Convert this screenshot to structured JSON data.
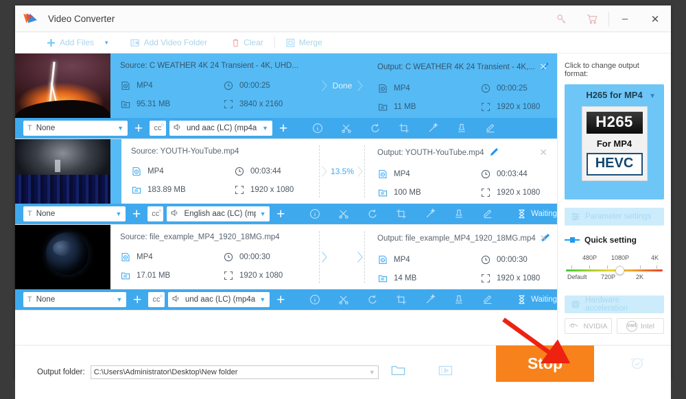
{
  "window": {
    "title": "Video Converter",
    "logo_icon": "video-converter-logo",
    "key_icon": "key-icon",
    "cart_icon": "shopping-cart-icon",
    "minimize_label": "–",
    "close_label": "✕"
  },
  "toolbar": {
    "add_files": "Add Files",
    "add_files_caret": "▾",
    "add_video_folder": "Add Video Folder",
    "clear": "Clear",
    "merge": "Merge"
  },
  "files": [
    {
      "thumb": "lightning-storm-thumbnail",
      "state": "done",
      "status": "Done",
      "source_label": "Source: C  WEATHER  4K 24  Transient - 4K, UHD...",
      "source_format": "MP4",
      "source_duration": "00:00:25",
      "source_size": "95.31 MB",
      "source_resolution": "3840 x 2160",
      "output_label": "Output: C  WEATHER  4K 24  Transient - 4K,...",
      "output_format": "MP4",
      "output_duration": "00:00:25",
      "output_size": "11 MB",
      "output_resolution": "1920 x 1080",
      "subtitle_track": "None",
      "audio_track": "und aac (LC) (mp4a",
      "queue_label": ""
    },
    {
      "thumb": "concert-crowd-thumbnail",
      "state": "converting",
      "status": "13.5%",
      "source_label": "Source: YOUTH-YouTube.mp4",
      "source_format": "MP4",
      "source_duration": "00:03:44",
      "source_size": "183.89 MB",
      "source_resolution": "1920 x 1080",
      "output_label": "Output: YOUTH-YouTube.mp4",
      "output_format": "MP4",
      "output_duration": "00:03:44",
      "output_size": "100 MB",
      "output_resolution": "1920 x 1080",
      "subtitle_track": "None",
      "audio_track": "English aac (LC) (mp",
      "queue_label": "Waiting"
    },
    {
      "thumb": "earth-space-thumbnail",
      "state": "queued",
      "status": "",
      "source_label": "Source: file_example_MP4_1920_18MG.mp4",
      "source_format": "MP4",
      "source_duration": "00:00:30",
      "source_size": "17.01 MB",
      "source_resolution": "1920 x 1080",
      "output_label": "Output: file_example_MP4_1920_18MG.mp4",
      "output_format": "MP4",
      "output_duration": "00:00:30",
      "output_size": "14 MB",
      "output_resolution": "1920 x 1080",
      "subtitle_track": "None",
      "audio_track": "und aac (LC) (mp4a",
      "queue_label": "Waiting"
    }
  ],
  "edit_tools": [
    "info-icon",
    "trim-icon",
    "rotate-icon",
    "crop-icon",
    "effect-icon",
    "watermark-icon",
    "subtitle-icon"
  ],
  "right_panel": {
    "prompt": "Click to change output format:",
    "format_name": "H265 for MP4",
    "codec_badge": "H265",
    "for_label": "For MP4",
    "hevc_label": "HEVC",
    "parameter_settings": "Parameter settings",
    "quick_setting": "Quick setting",
    "slider_top_labels": [
      "480P",
      "1080P",
      "4K"
    ],
    "slider_bottom_labels": [
      "Default",
      "720P",
      "2K"
    ],
    "slider_value": "1080P",
    "hardware_acceleration": "Hardware acceleration",
    "vendors": [
      "NVIDIA",
      "Intel"
    ]
  },
  "bottom": {
    "output_folder_label": "Output folder:",
    "output_folder_path": "C:\\Users\\Administrator\\Desktop\\New folder",
    "folder_icon": "open-folder-icon",
    "film_icon": "film-strip-icon",
    "stop_label": "Stop",
    "alarm_icon": "alarm-clock-icon",
    "stop_color": "#f7821b"
  },
  "annotation": {
    "arrow_color": "#ee2211"
  }
}
